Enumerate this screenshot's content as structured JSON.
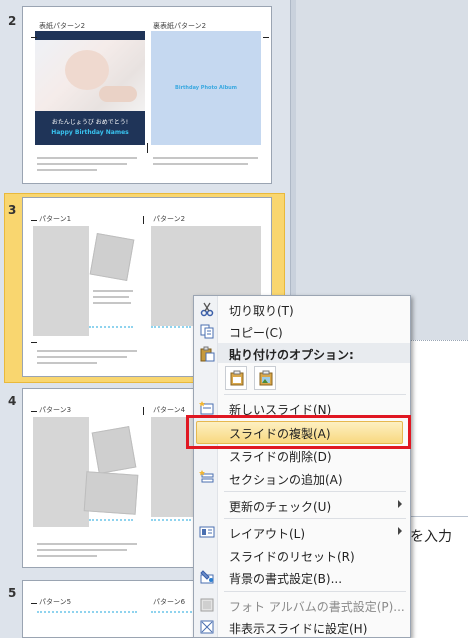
{
  "slide_panel": {
    "slides": [
      {
        "number": "2",
        "pages": [
          "表紙パターン2",
          "裏表紙パターン2"
        ],
        "photo_caption": "おたんじょうび おめでとう!",
        "banner": "Happy Birthday Names",
        "album_title": "Birthday Photo Album"
      },
      {
        "number": "3",
        "pages": [
          "パターン1",
          "パターン2"
        ],
        "selected": true
      },
      {
        "number": "4",
        "pages": [
          "パターン3",
          "パターン4"
        ]
      },
      {
        "number": "5",
        "pages": [
          "パターン5",
          "パターン6"
        ]
      }
    ]
  },
  "notes": {
    "placeholder_fragment": "を入力"
  },
  "context_menu": {
    "items": [
      {
        "label": "切り取り(T)",
        "icon": "scissors-icon"
      },
      {
        "label": "コピー(C)",
        "icon": "copy-icon"
      },
      {
        "label": "貼り付けのオプション:",
        "icon": "clipboard-icon",
        "header": true
      },
      {
        "label": "新しいスライド(N)",
        "icon": "new-slide-icon"
      },
      {
        "label": "スライドの複製(A)",
        "highlighted": true
      },
      {
        "label": "スライドの削除(D)"
      },
      {
        "label": "セクションの追加(A)",
        "icon": "section-icon"
      },
      {
        "label": "更新のチェック(U)",
        "submenu": true
      },
      {
        "label": "レイアウト(L)",
        "icon": "layout-icon",
        "submenu": true
      },
      {
        "label": "スライドのリセット(R)"
      },
      {
        "label": "背景の書式設定(B)...",
        "icon": "background-icon"
      },
      {
        "label": "フォト アルバムの書式設定(P)...",
        "icon": "photo-album-icon",
        "disabled": true
      },
      {
        "label": "非表示スライドに設定(H)",
        "icon": "hide-slide-icon"
      }
    ]
  },
  "colors": {
    "highlight": "#f8d880",
    "annotation": "#e01722",
    "selected_slide": "#f9d66f"
  }
}
